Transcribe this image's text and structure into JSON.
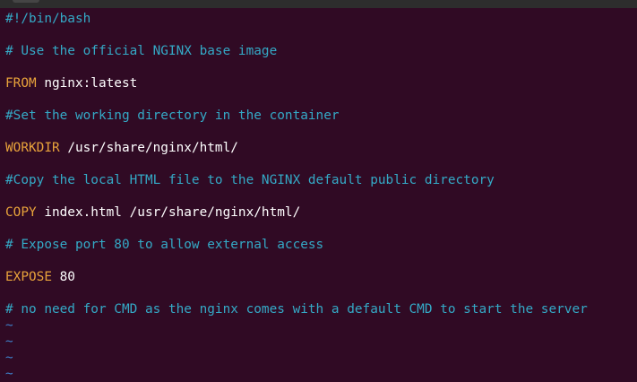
{
  "editor": {
    "lines": [
      {
        "kind": "comment",
        "text": "#!/bin/bash"
      },
      {
        "kind": "blank",
        "text": ""
      },
      {
        "kind": "comment",
        "text": "# Use the official NGINX base image"
      },
      {
        "kind": "blank",
        "text": ""
      },
      {
        "kind": "instruction",
        "keyword": "FROM",
        "args": " nginx:latest"
      },
      {
        "kind": "blank",
        "text": ""
      },
      {
        "kind": "comment",
        "text": "#Set the working directory in the container"
      },
      {
        "kind": "blank",
        "text": ""
      },
      {
        "kind": "instruction",
        "keyword": "WORKDIR",
        "args": " /usr/share/nginx/html/"
      },
      {
        "kind": "blank",
        "text": ""
      },
      {
        "kind": "comment",
        "text": "#Copy the local HTML file to the NGINX default public directory"
      },
      {
        "kind": "blank",
        "text": ""
      },
      {
        "kind": "instruction",
        "keyword": "COPY",
        "args": " index.html /usr/share/nginx/html/"
      },
      {
        "kind": "blank",
        "text": ""
      },
      {
        "kind": "comment",
        "text": "# Expose port 80 to allow external access"
      },
      {
        "kind": "blank",
        "text": ""
      },
      {
        "kind": "instruction",
        "keyword": "EXPOSE",
        "args": " 80"
      },
      {
        "kind": "blank",
        "text": ""
      },
      {
        "kind": "comment",
        "text": "# no need for CMD as the nginx comes with a default CMD to start the server"
      }
    ],
    "empty_markers": [
      "~",
      "~",
      "~",
      "~"
    ]
  },
  "colors": {
    "background": "#300a24",
    "comment": "#34a9c6",
    "keyword": "#e8a33b",
    "text": "#ffffff",
    "tilde": "#3e7fc8"
  }
}
